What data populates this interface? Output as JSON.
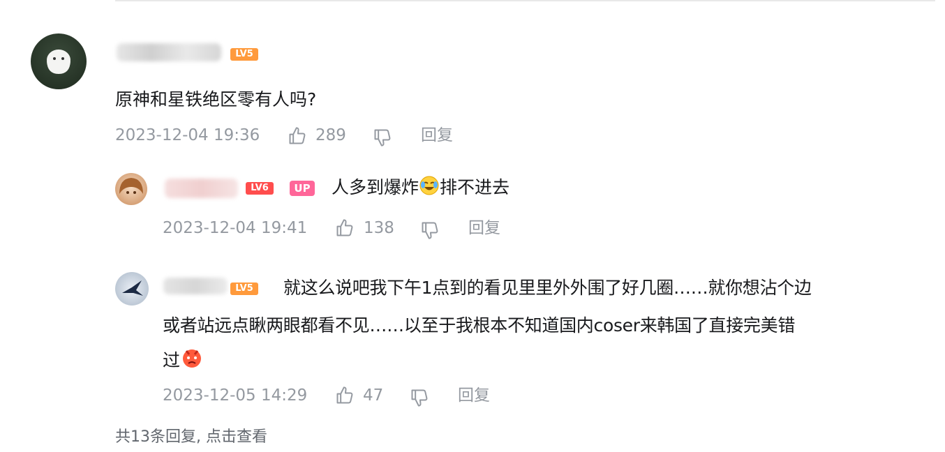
{
  "comment": {
    "level_badge": "LV5",
    "text": "原神和星铁绝区零有人吗?",
    "time": "2023-12-04 19:36",
    "likes": "289",
    "reply_label": "回复"
  },
  "replies": [
    {
      "level_badge": "LV6",
      "up_badge": "UP",
      "text_before": "人多到爆炸",
      "text_after": "排不进去",
      "time": "2023-12-04 19:41",
      "likes": "138",
      "reply_label": "回复"
    },
    {
      "level_badge": "LV5",
      "line1": "就这么说吧我下午1点到的看见里里外外围了好几圈……就你想沾个边",
      "line2": "或者站远点瞅两眼都看不见……以至于我根本不知道国内coser来韩国了直接完美错",
      "line3": "过",
      "time": "2023-12-05 14:29",
      "likes": "47",
      "reply_label": "回复"
    }
  ],
  "more_replies": "共13条回复, 点击查看",
  "colors": {
    "lv5": "#ff9a3c",
    "lv6": "#ff4d4d",
    "up": "#ff6699",
    "meta": "#9499a0"
  }
}
